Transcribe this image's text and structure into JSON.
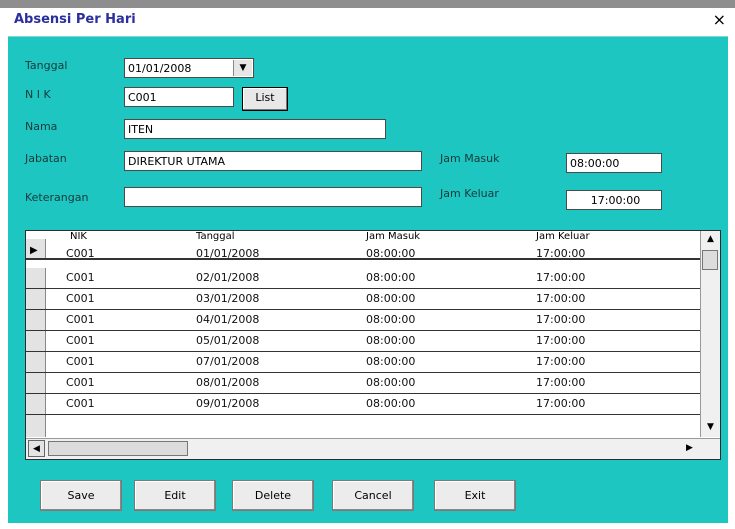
{
  "window": {
    "title": "Absensi Per Hari",
    "close_glyph": "×"
  },
  "form": {
    "tanggal_label": "Tanggal",
    "tanggal_value": "01/01/2008",
    "nik_label": "N I K",
    "nik_value": "C001",
    "list_button": "List",
    "nama_label": "Nama",
    "nama_value": "ITEN",
    "jabatan_label": "Jabatan",
    "jabatan_value": "DIREKTUR UTAMA",
    "keterangan_label": "Keterangan",
    "keterangan_value": "",
    "jam_masuk_label": "Jam Masuk",
    "jam_masuk_value": "08:00:00",
    "jam_keluar_label": "Jam Keluar",
    "jam_keluar_value": "17:00:00"
  },
  "grid": {
    "columns": [
      "NIK",
      "Tanggal",
      "Jam Masuk",
      "Jam Keluar"
    ],
    "rows": [
      [
        "C001",
        "01/01/2008",
        "08:00:00",
        "17:00:00"
      ],
      [
        "C001",
        "02/01/2008",
        "08:00:00",
        "17:00:00"
      ],
      [
        "C001",
        "03/01/2008",
        "08:00:00",
        "17:00:00"
      ],
      [
        "C001",
        "04/01/2008",
        "08:00:00",
        "17:00:00"
      ],
      [
        "C001",
        "05/01/2008",
        "08:00:00",
        "17:00:00"
      ],
      [
        "C001",
        "07/01/2008",
        "08:00:00",
        "17:00:00"
      ],
      [
        "C001",
        "08/01/2008",
        "08:00:00",
        "17:00:00"
      ],
      [
        "C001",
        "09/01/2008",
        "08:00:00",
        "17:00:00"
      ]
    ],
    "current_row_marker": "▶"
  },
  "buttons": {
    "save": "Save",
    "edit": "Edit",
    "delete": "Delete",
    "cancel": "Cancel",
    "exit": "Exit"
  },
  "colors": {
    "panel": "#1ec6c2",
    "title": "#2a2f9e"
  }
}
